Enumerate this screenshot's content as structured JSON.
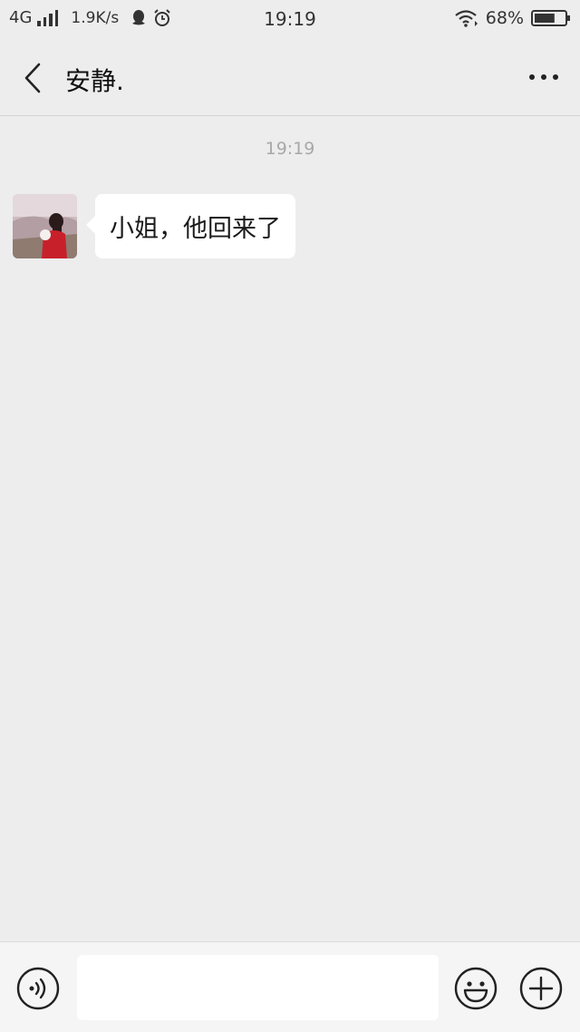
{
  "status_bar": {
    "network": "4G",
    "speed": "1.9K/s",
    "time": "19:19",
    "battery": "68%",
    "battery_level": 0.68,
    "icons": [
      "signal-icon",
      "qq-icon",
      "alarm-icon",
      "wifi-icon",
      "battery-icon"
    ]
  },
  "header": {
    "title": "安静.",
    "back_icon": "chevron-left-icon",
    "more_icon": "more-dots-icon"
  },
  "messages": {
    "timestamp": "19:19",
    "items": [
      {
        "sender": "contact",
        "text": "小姐，他回来了"
      }
    ]
  },
  "input_bar": {
    "placeholder": "",
    "value": "",
    "voice_icon": "voice-icon",
    "emoji_icon": "emoji-icon",
    "plus_icon": "plus-icon"
  },
  "colors": {
    "background": "#ededed",
    "bubble": "#ffffff",
    "timestamp_text": "#a8a8a8"
  }
}
